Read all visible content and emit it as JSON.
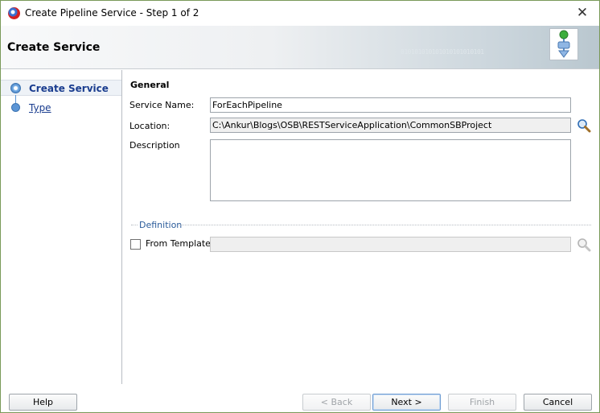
{
  "window": {
    "title": "Create Pipeline Service - Step 1 of 2",
    "close_symbol": "✕"
  },
  "header": {
    "title": "Create Service",
    "binary_text": "010101010101010101010101",
    "icon": "pipeline-wizard-icon"
  },
  "nav": {
    "items": [
      {
        "label": "Create Service",
        "state": "current"
      },
      {
        "label": "Type",
        "state": "next"
      }
    ]
  },
  "form": {
    "section_title": "General",
    "service_name": {
      "label": "Service Name:",
      "value": "ForEachPipeline"
    },
    "location": {
      "label": "Location:",
      "value": "C:\\Ankur\\Blogs\\OSB\\RESTServiceApplication\\CommonSBProject"
    },
    "description": {
      "label": "Description",
      "value": ""
    },
    "definition": {
      "title": "Definition",
      "from_template": {
        "label": "From Template",
        "checked": false,
        "value": ""
      }
    }
  },
  "buttons": {
    "help": "Help",
    "back": "< Back",
    "next": "Next >",
    "finish": "Finish",
    "cancel": "Cancel"
  },
  "colors": {
    "nav_text": "#1a3d8f",
    "definition_label": "#2a5b9a",
    "nav_dot": "#5b95d6"
  }
}
